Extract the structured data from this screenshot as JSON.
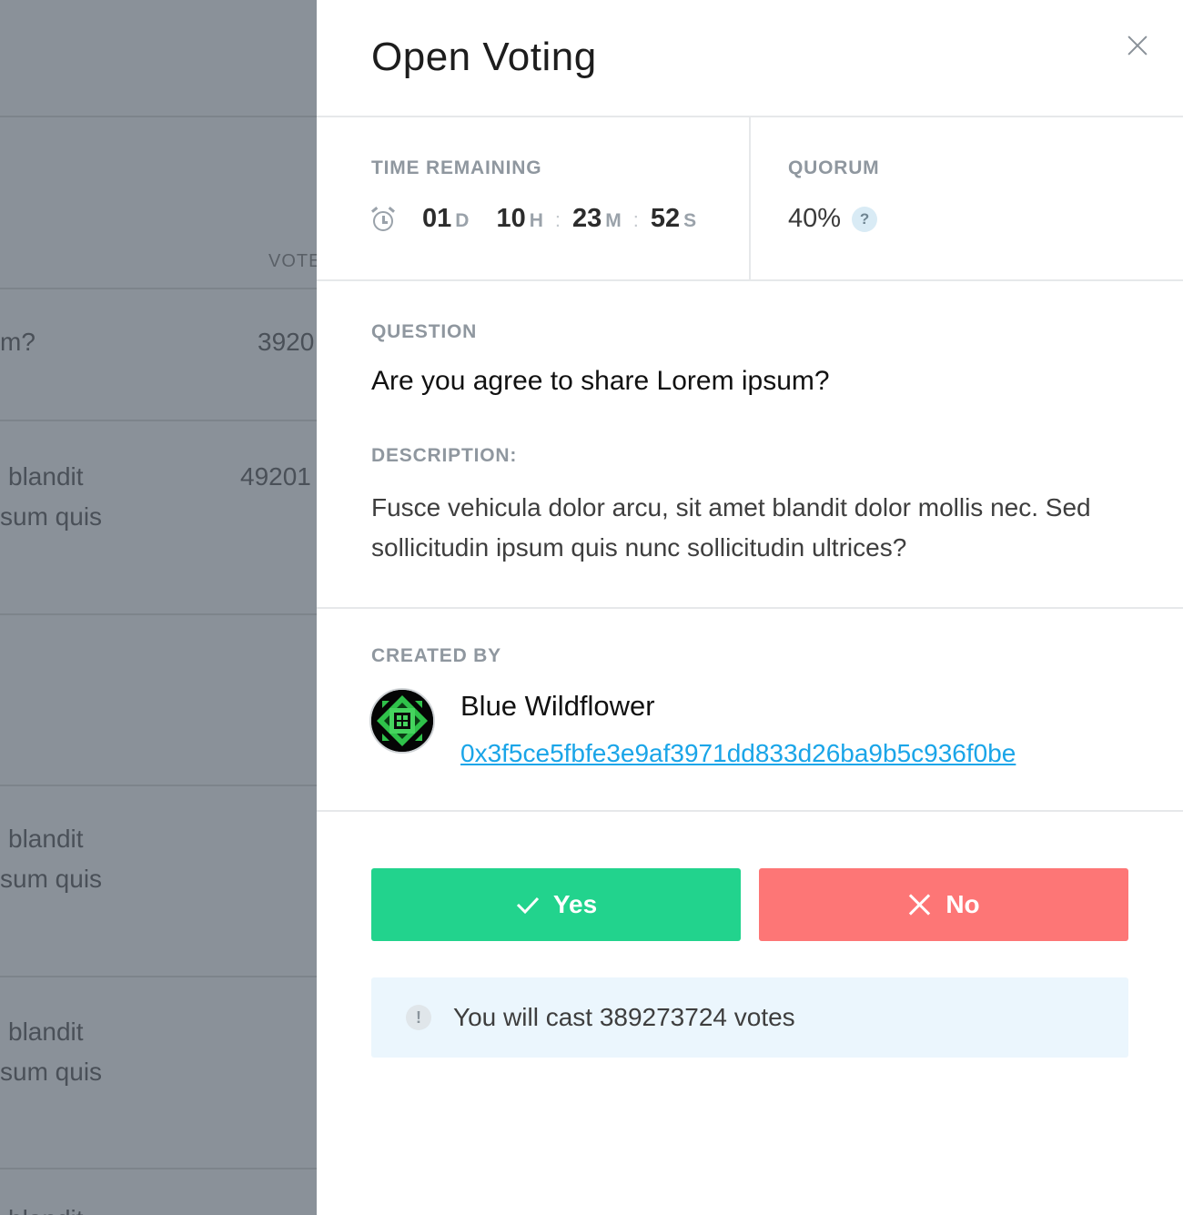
{
  "background": {
    "header_col": "VOTE",
    "rows": [
      {
        "text": "m?",
        "value": "3920"
      },
      {
        "text_line1": "blandit",
        "text_line2": "sum quis",
        "value": "49201"
      },
      {
        "text_line1": "blandit",
        "text_line2": "sum quis"
      },
      {
        "text_line1": "blandit",
        "text_line2": "sum quis"
      },
      {
        "text": "blandit"
      }
    ]
  },
  "panel": {
    "title": "Open Voting",
    "time_remaining": {
      "label": "TIME REMAINING",
      "days": "01",
      "days_unit": "D",
      "hours": "10",
      "hours_unit": "H",
      "minutes": "23",
      "minutes_unit": "M",
      "seconds": "52",
      "seconds_unit": "S",
      "separator": ":"
    },
    "quorum": {
      "label": "QUORUM",
      "value": "40%",
      "help": "?"
    },
    "question": {
      "label": "QUESTION",
      "text": "Are you agree to share Lorem ipsum?"
    },
    "description": {
      "label": "DESCRIPTION:",
      "text": "Fusce vehicula dolor arcu, sit amet blandit dolor mollis nec. Sed sollicitudin ipsum quis nunc sollicitudin ultrices?"
    },
    "created_by": {
      "label": "CREATED BY",
      "name": "Blue Wildflower",
      "address": "0x3f5ce5fbfe3e9af3971dd833d26ba9b5c936f0be"
    },
    "actions": {
      "yes_label": "Yes",
      "no_label": "No"
    },
    "info": {
      "icon": "!",
      "text": "You will cast 389273724 votes"
    }
  },
  "colors": {
    "yes": "#22d38d",
    "no": "#fd7676",
    "link": "#1aa5e8",
    "info_bg": "#ebf6fd"
  }
}
